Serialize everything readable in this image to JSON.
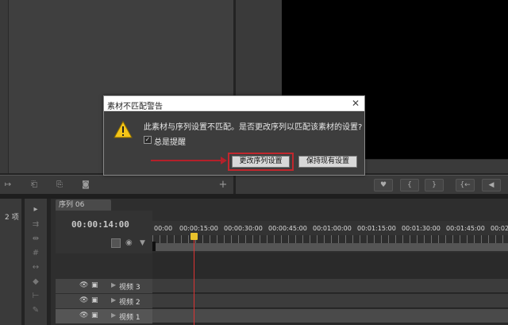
{
  "dialog": {
    "title": "素材不匹配警告",
    "close_glyph": "✕",
    "message": "此素材与序列设置不匹配。是否更改序列以匹配该素材的设置?",
    "checkbox_label": "总是提醒",
    "checkbox_checked": true,
    "primary_button": "更改序列设置",
    "secondary_button": "保持现有设置"
  },
  "project_panel": {
    "item_count": "2 项"
  },
  "timeline": {
    "tab_label": "序列 06",
    "timecode": "00:00:14:00",
    "ruler_labels": [
      "00:00",
      "00:00:15:00",
      "00:00:30:00",
      "00:00:45:00",
      "00:01:00:00",
      "00:01:15:00",
      "00:01:30:00",
      "00:01:45:00",
      "00:02"
    ],
    "tracks": [
      {
        "name": "视频 3"
      },
      {
        "name": "视频 2"
      },
      {
        "name": "视频 1"
      }
    ]
  },
  "source_controls": [
    "↦",
    "⎗",
    "⎘",
    "◙",
    "+"
  ],
  "program_controls": [
    "♥",
    "{",
    "}",
    "{←",
    "◀"
  ],
  "colors": {
    "highlight_red": "#c1272d",
    "playhead": "#e8c22c",
    "warning_yellow": "#f5c518"
  }
}
